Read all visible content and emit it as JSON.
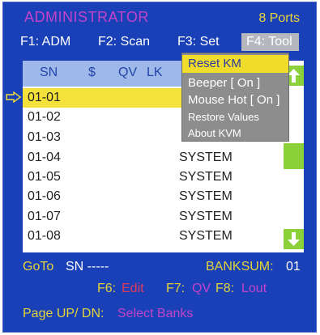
{
  "header": {
    "title": "ADMINISTRATOR",
    "ports": "8 Ports"
  },
  "fkeys": [
    {
      "label": "F1: ADM"
    },
    {
      "label": "F2: Scan"
    },
    {
      "label": "F3: Set"
    },
    {
      "label": "F4: Tool",
      "active": true
    }
  ],
  "table": {
    "columns": [
      "SN",
      "$",
      "QV",
      "LK"
    ],
    "rows": [
      {
        "sn": "01-01",
        "name": "",
        "selected": true
      },
      {
        "sn": "01-02",
        "name": ""
      },
      {
        "sn": "01-03",
        "name": ""
      },
      {
        "sn": "01-04",
        "name": "SYSTEM"
      },
      {
        "sn": "01-05",
        "name": "SYSTEM"
      },
      {
        "sn": "01-06",
        "name": "SYSTEM"
      },
      {
        "sn": "01-07",
        "name": "SYSTEM"
      },
      {
        "sn": "01-08",
        "name": "SYSTEM"
      }
    ]
  },
  "menu": {
    "items": [
      {
        "label": "Reset KM",
        "highlighted": true
      },
      {
        "label": "Beeper [ On ]"
      },
      {
        "label": "Mouse Hot [ On ]"
      },
      {
        "label": "Restore Values"
      },
      {
        "label": "About KVM"
      }
    ]
  },
  "footer": {
    "goto_label": "GoTo",
    "sn_value": "SN -----",
    "banksum_label": "BANKSUM:",
    "banksum_value": "01",
    "f6_key": "F6:",
    "f6_value": "Edit",
    "f7_key": "F7:",
    "f7_value": "QV",
    "f8_key": "F8:",
    "f8_value": "Lout",
    "page_label": "Page UP/ DN:",
    "page_value": "Select Banks"
  },
  "colors": {
    "background": "#1a40b8",
    "highlight": "#f4e23a",
    "scroll": "#8cd03a",
    "menu": "#8d8d8d",
    "magenta": "#c243c8",
    "yellow": "#e2d43a"
  },
  "icons": [
    "pointer-arrow-icon",
    "scroll-up-arrow-icon",
    "scroll-down-arrow-icon"
  ]
}
